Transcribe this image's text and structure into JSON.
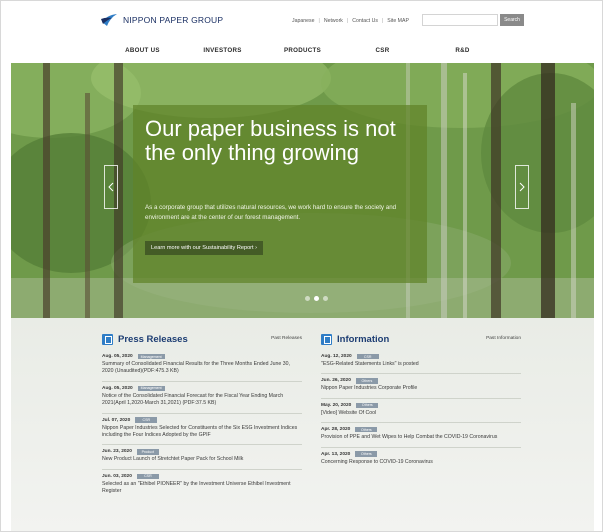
{
  "header": {
    "logo_text": "NIPPON PAPER GROUP",
    "utility_links": [
      "Japanese",
      "Network",
      "Contact Us",
      "Site MAP"
    ],
    "search_placeholder": "",
    "search_button": "Search"
  },
  "nav": {
    "items": [
      "ABOUT US",
      "INVESTORS",
      "PRODUCTS",
      "CSR",
      "R&D"
    ]
  },
  "hero": {
    "title": "Our paper business is not the only thing growing",
    "description": "As a corporate group that utilizes natural resources, we work hard to ensure the society and environment are at the center of our forest management.",
    "link": "Learn more with our Sustainability Report ›",
    "slides": 3,
    "active_slide": 2
  },
  "press": {
    "title": "Press Releases",
    "past_link": "Past Releases",
    "items": [
      {
        "date": "Aug. 05, 2020",
        "tag": "Management",
        "text": "Summary of Consolidated Financial Results for the Three Months Ended June 30, 2020 (Unaudited)(PDF:475.3 KB)"
      },
      {
        "date": "Aug. 05, 2020",
        "tag": "Management",
        "text": "Notice of the Consolidated Financial Forecast for the Fiscal Year Ending March 2021(April 1,2020-March 31,2021) (PDF:37.5 KB)"
      },
      {
        "date": "Jul. 07, 2020",
        "tag": "CSR",
        "text": "Nippon Paper Industries Selected for Constituents of the Six ESG Investment Indices including the Four Indices Adopted by the GPIF"
      },
      {
        "date": "Jun. 23, 2020",
        "tag": "Product",
        "text": "New Product Launch of Stretchtet Paper Pack for School Milk"
      },
      {
        "date": "Jun. 03, 2020",
        "tag": "CSR",
        "text": "Selected as an \"Ethibel PIONEER\" by the Investment Universe Ethibel Investment Register"
      }
    ]
  },
  "information": {
    "title": "Information",
    "past_link": "Past Information",
    "items": [
      {
        "date": "Aug. 12, 2020",
        "tag": "CSR",
        "text": "\"ESG-Related Statements Links\" is posted"
      },
      {
        "date": "Jun. 26, 2020",
        "tag": "Others",
        "text": "Nippon Paper Industries Corporate Profile"
      },
      {
        "date": "May. 20, 2020",
        "tag": "Others",
        "text": "[Video] Website Of Cool"
      },
      {
        "date": "Apr. 28, 2020",
        "tag": "Others",
        "text": "Provision of PPE and Wet Wipes to Help Combat the COVID-19 Coronavirus"
      },
      {
        "date": "Apr. 13, 2020",
        "tag": "Others",
        "text": "Concerning Response to COVID-19 Coronavirus"
      }
    ]
  },
  "colors": {
    "brand": "#1a2f63",
    "accent": "#2f7dc6",
    "hero_panel": "#608228",
    "tag": "#8b9aa8"
  }
}
